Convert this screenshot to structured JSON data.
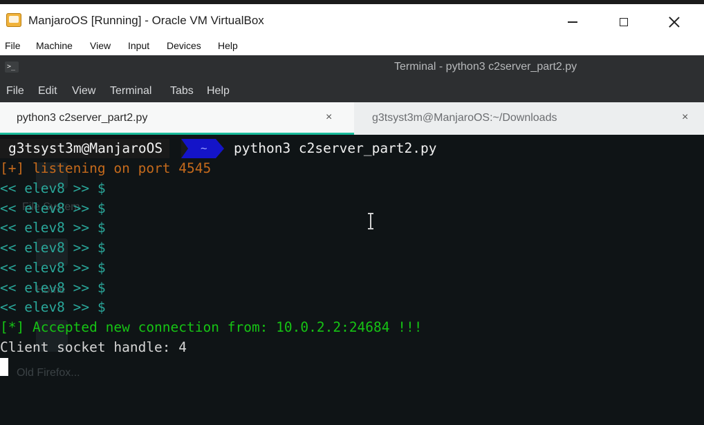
{
  "vbox": {
    "title": "ManjaroOS [Running] - Oracle VM VirtualBox",
    "menu": [
      "File",
      "Machine",
      "View",
      "Input",
      "Devices",
      "Help"
    ]
  },
  "terminal_window": {
    "title": "Terminal - python3 c2server_part2.py",
    "menu": [
      "File",
      "Edit",
      "View",
      "Terminal",
      "Tabs",
      "Help"
    ],
    "tabs": [
      {
        "label": "python3 c2server_part2.py",
        "active": true
      },
      {
        "label": "g3tsyst3m@ManjaroOS:~/Downloads",
        "active": false
      }
    ],
    "tab_close_glyph": "×"
  },
  "prompt": {
    "user": "g3tsyst3m@ManjaroOS",
    "dir": "~",
    "command": "python3 c2server_part2.py"
  },
  "output": {
    "listening": "[+] listening on port 4545",
    "elev_prompt": "<< elev8 >> $",
    "accepted": "[*] Accepted new connection from: 10.0.2.2:24684 !!!",
    "socket": "Client socket handle: 4"
  },
  "ghost_desktop": {
    "file_system": "File System",
    "home": "Home",
    "old_firefox": "Old Firefox..."
  },
  "colors": {
    "accent_tab": "#1abc9c",
    "orange": "#c56a1c",
    "teal": "#2aa79a",
    "green": "#16c414",
    "prompt_dir_blue": "#1414c8"
  }
}
